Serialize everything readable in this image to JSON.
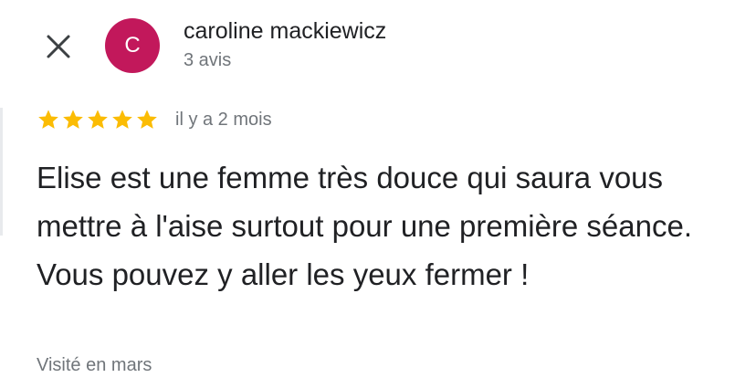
{
  "close": {
    "icon": "close-icon"
  },
  "author": {
    "initial": "C",
    "name": "caroline mackiewicz",
    "meta": "3 avis",
    "avatar_color": "#c2185b"
  },
  "review": {
    "rating": 5,
    "max_rating": 5,
    "star_color": "#fbbc04",
    "time_ago": "il y a 2 mois",
    "text": "Elise est une femme très douce qui saura vous mettre à l'aise surtout pour une première séance. Vous pouvez y aller les yeux fermer !",
    "visited": "Visité en mars"
  }
}
